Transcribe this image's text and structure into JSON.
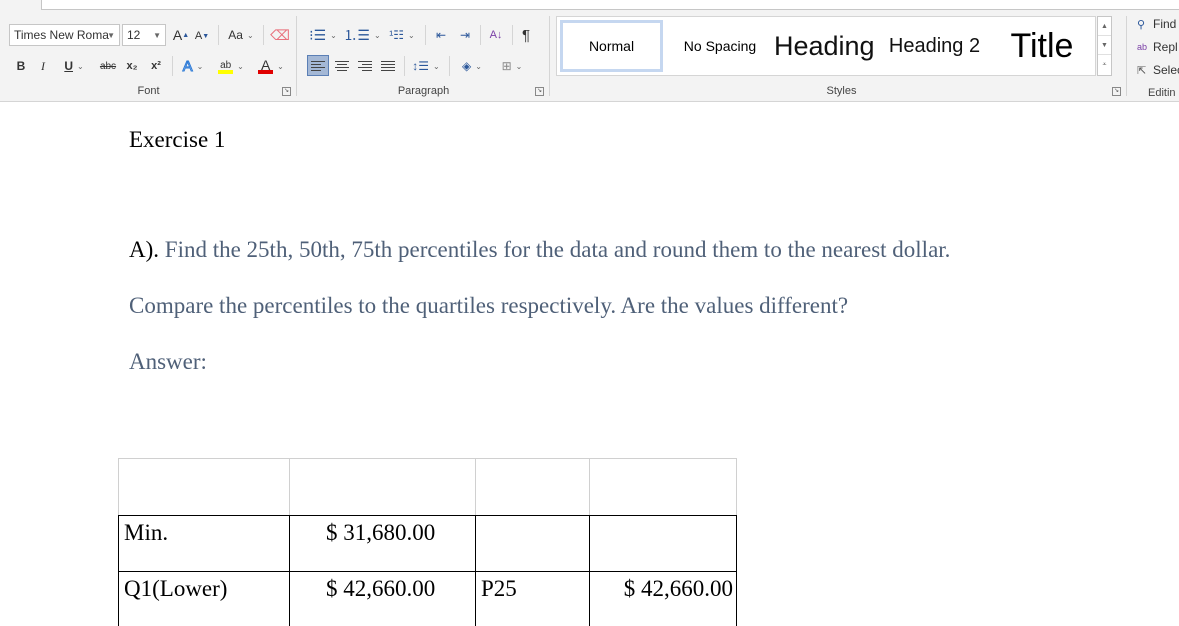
{
  "ribbon": {
    "font": {
      "group_label": "Font",
      "font_name": "Times New Roma",
      "font_size": "12",
      "grow_font": "A",
      "shrink_font": "A",
      "change_case": "Aa",
      "bold": "B",
      "italic": "I",
      "underline": "U",
      "strikethrough": "abc",
      "subscript": "x₂",
      "superscript": "x²",
      "text_effects": "A",
      "highlight": "ab",
      "font_color": "A",
      "highlight_color": "#ffff00",
      "font_color_value": "#e00000"
    },
    "paragraph": {
      "group_label": "Paragraph",
      "sort": "A↓",
      "pilcrow": "¶"
    },
    "styles": {
      "group_label": "Styles",
      "items": [
        "Normal",
        "No Spacing",
        "Heading",
        "Heading 2",
        "Title"
      ],
      "selected": "Normal"
    },
    "editing": {
      "group_label": "Editin",
      "find": "Find",
      "replace": "Repl",
      "select": "Selec"
    }
  },
  "document": {
    "heading": "Exercise 1",
    "question_lead": "A).",
    "question_text": " Find the 25th, 50th, 75th percentiles for the data and round them to the nearest dollar.",
    "compare_text": "Compare the percentiles to the quartiles respectively. Are the values different?",
    "answer_label": "Answer:",
    "text_color": "#4f6078",
    "table": {
      "rows": [
        [
          "",
          "",
          "",
          ""
        ],
        [
          "Min.",
          "$ 31,680.00",
          "",
          ""
        ],
        [
          "Q1(Lower)",
          "$ 42,660.00",
          "P25",
          "$ 42,660.00"
        ]
      ]
    }
  }
}
